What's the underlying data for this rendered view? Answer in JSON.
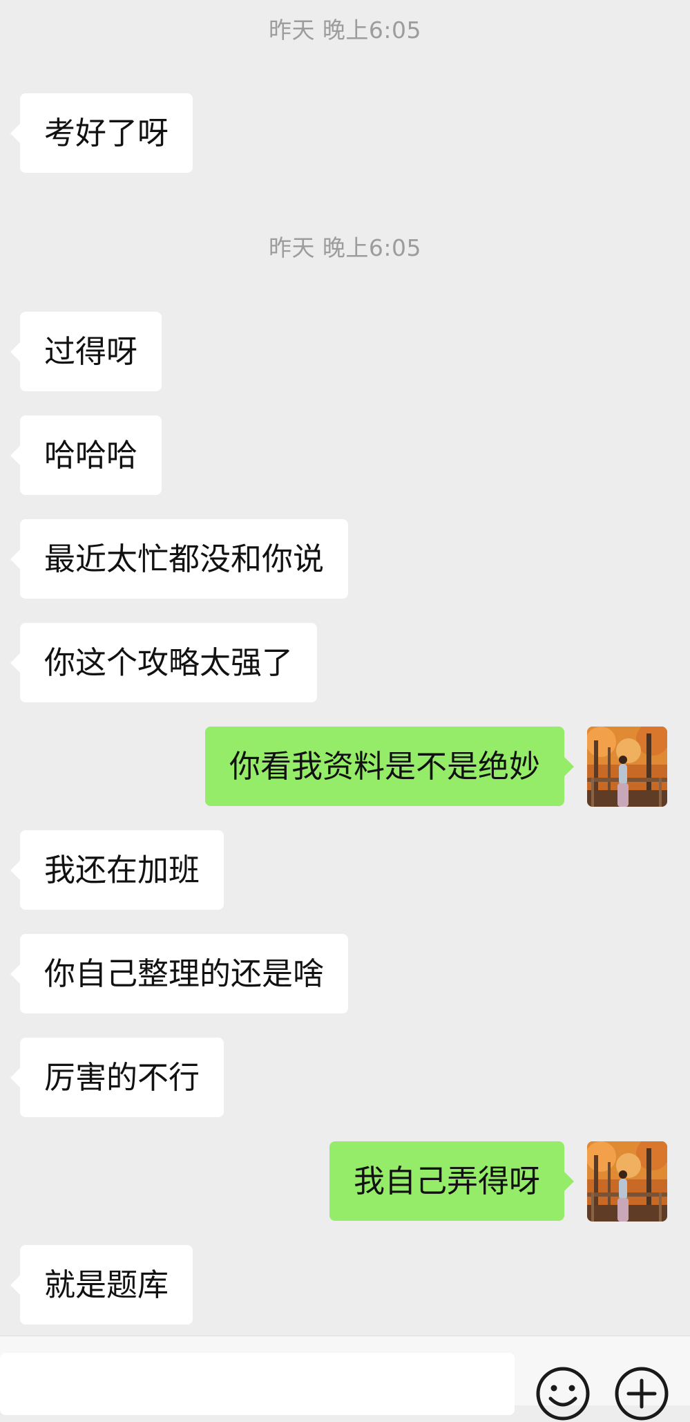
{
  "messages": [
    {
      "type": "time",
      "text": "昨天 晚上6:05"
    },
    {
      "type": "in",
      "text": "考好了呀"
    },
    {
      "type": "time",
      "text": "昨天 晚上6:05"
    },
    {
      "type": "in",
      "text": "过得呀"
    },
    {
      "type": "in",
      "text": "哈哈哈"
    },
    {
      "type": "in",
      "text": "最近太忙都没和你说"
    },
    {
      "type": "in",
      "text": "你这个攻略太强了"
    },
    {
      "type": "out",
      "text": "你看我资料是不是绝妙"
    },
    {
      "type": "in",
      "text": "我还在加班"
    },
    {
      "type": "in",
      "text": "你自己整理的还是啥"
    },
    {
      "type": "in",
      "text": "厉害的不行"
    },
    {
      "type": "out",
      "text": "我自己弄得呀"
    },
    {
      "type": "in",
      "text": "就是题库"
    }
  ],
  "input_bar": {
    "emoji_icon": "emoji-icon",
    "more_icon": "plus-circle-icon"
  },
  "colors": {
    "background": "#ededed",
    "incoming_bubble": "#ffffff",
    "outgoing_bubble": "#95ec69",
    "timestamp_text": "#9c9c9c"
  }
}
